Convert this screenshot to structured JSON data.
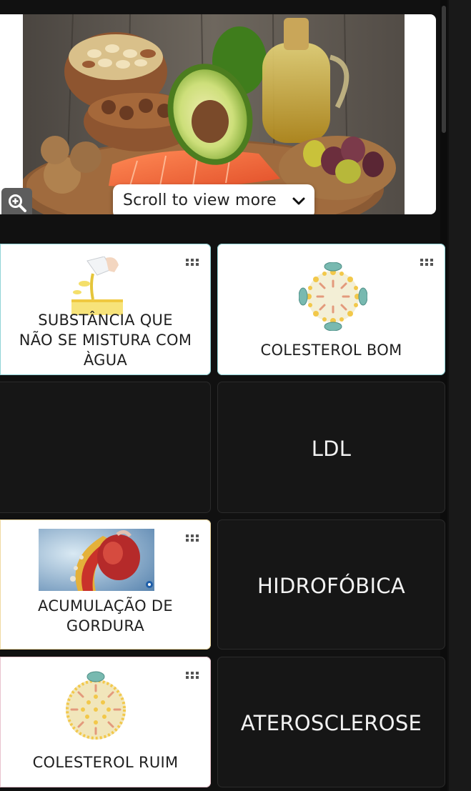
{
  "hero": {
    "image_alt": "Healthy fats: nuts, avocado, salmon, olive oil and olives",
    "zoom_icon": "zoom-in-icon",
    "scroll_hint": "Scroll to view more",
    "scroll_icon": "chevron-down-icon"
  },
  "cards": [
    {
      "id": "substance",
      "text": "SUBSTÂNCIA QUE NÃO SE MISTURA COM ÀGUA",
      "lines": [
        "SUBSTÂNCIA QUE",
        "NÃO SE MISTURA COM",
        "ÀGUA"
      ],
      "style": "light",
      "image": "oil-pouring-into-water"
    },
    {
      "id": "hdl",
      "text": "COLESTEROL BOM",
      "style": "light",
      "image": "lipoprotein-particle"
    },
    {
      "id": "empty",
      "text": "",
      "style": "dark"
    },
    {
      "id": "ldl",
      "text": "LDL",
      "style": "dark"
    },
    {
      "id": "fat",
      "text": "ACUMULAÇÃO DE GORDURA",
      "lines": [
        "ACUMULAÇÃO DE",
        "GORDURA"
      ],
      "style": "light",
      "image": "artery-plaque-heart"
    },
    {
      "id": "hydro",
      "text": "HIDROFÓBICA",
      "style": "dark"
    },
    {
      "id": "ldl-bad",
      "text": "COLESTEROL RUIM",
      "style": "light",
      "image": "lipoprotein-particle"
    },
    {
      "id": "athero",
      "text": "ATEROSCLEROSE",
      "style": "dark"
    }
  ],
  "colors": {
    "background": "#111111",
    "card_light": "#ffffff",
    "card_dark": "#161616",
    "card_border_teal": "#8fd3d6",
    "card_border_gold": "#f0d9a0",
    "card_border_pink": "#e9c3cd"
  }
}
